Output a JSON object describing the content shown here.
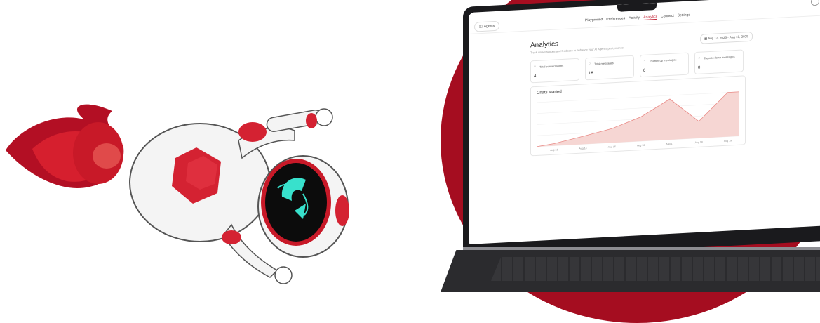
{
  "colors": {
    "brand_red": "#a50d20",
    "accent_red": "#c2293a",
    "chart_fill": "#f6d6d3",
    "chart_line": "#e98a86",
    "teal": "#38e1cc"
  },
  "app": {
    "agents_label": "Agents",
    "nav_tabs": [
      "Playground",
      "Preferences",
      "Activity",
      "Analytics",
      "Connect",
      "Settings"
    ],
    "active_tab": "Analytics",
    "page_title": "Analytics",
    "page_subtitle": "Track conversations and feedback to enhance your AI Agent's performance",
    "date_range": "Aug 12, 2025 - Aug 19, 2025",
    "cards": [
      {
        "label": "Total conversations",
        "value": "4",
        "icon": "chat-icon"
      },
      {
        "label": "Total messages",
        "value": "18",
        "icon": "message-icon"
      },
      {
        "label": "Thumbs up messages",
        "value": "0",
        "icon": "thumbs-up-icon"
      },
      {
        "label": "Thumbs down messages",
        "value": "0",
        "icon": "thumbs-down-icon"
      }
    ]
  },
  "chart_data": {
    "type": "area",
    "title": "Chats started",
    "x": [
      "Aug 13",
      "Aug 14",
      "Aug 15",
      "Aug 16",
      "Aug 17",
      "Aug 18",
      "Aug 19"
    ],
    "values": [
      0.05,
      0.18,
      0.32,
      0.55,
      0.92,
      0.38,
      1.0
    ],
    "ylim": [
      0,
      1
    ],
    "grid": true
  }
}
